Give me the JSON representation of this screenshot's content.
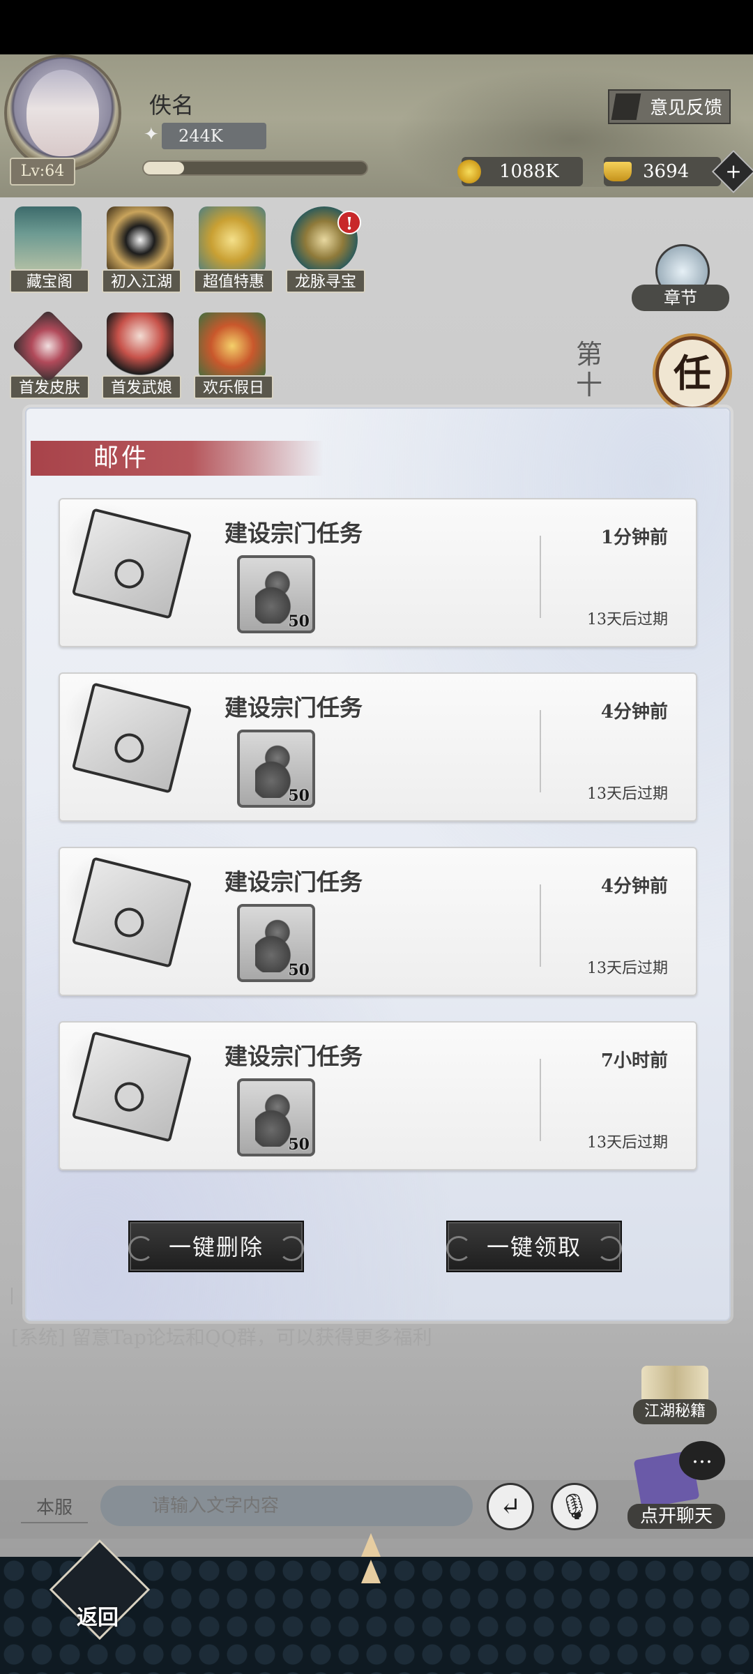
{
  "player": {
    "name": "佚名",
    "level": "Lv:64",
    "power": "244K",
    "xp_progress": 0.18
  },
  "header": {
    "feedback_label": "意见反馈",
    "gold": "1088K",
    "ingot": "3694"
  },
  "shortcuts": [
    {
      "label": "藏宝阁"
    },
    {
      "label": "初入江湖"
    },
    {
      "label": "超值特惠"
    },
    {
      "label": "龙脉寻宝",
      "badge": "!"
    },
    {
      "label": "首发皮肤"
    },
    {
      "label": "首发武娘"
    },
    {
      "label": "欢乐假日"
    }
  ],
  "side": {
    "chapter_label": "章节",
    "task_char": "任",
    "vertical_text": "第十",
    "secret_label": "江湖秘籍",
    "openchat_label": "点开聊天"
  },
  "mail": {
    "title": "邮件",
    "items": [
      {
        "title": "建设宗门任务",
        "reward_qty": "50",
        "time": "1分钟前",
        "expire": "13天后过期"
      },
      {
        "title": "建设宗门任务",
        "reward_qty": "50",
        "time": "4分钟前",
        "expire": "13天后过期"
      },
      {
        "title": "建设宗门任务",
        "reward_qty": "50",
        "time": "4分钟前",
        "expire": "13天后过期"
      },
      {
        "title": "建设宗门任务",
        "reward_qty": "50",
        "time": "7小时前",
        "expire": "13天后过期"
      }
    ],
    "delete_all_label": "一键删除",
    "claim_all_label": "一键领取"
  },
  "system_message": "[系统] 留意Tap论坛和QQ群，可以获得更多福利",
  "chat": {
    "server_label": "本服",
    "placeholder": "请输入文字内容"
  },
  "nav": {
    "back_label": "返回"
  }
}
